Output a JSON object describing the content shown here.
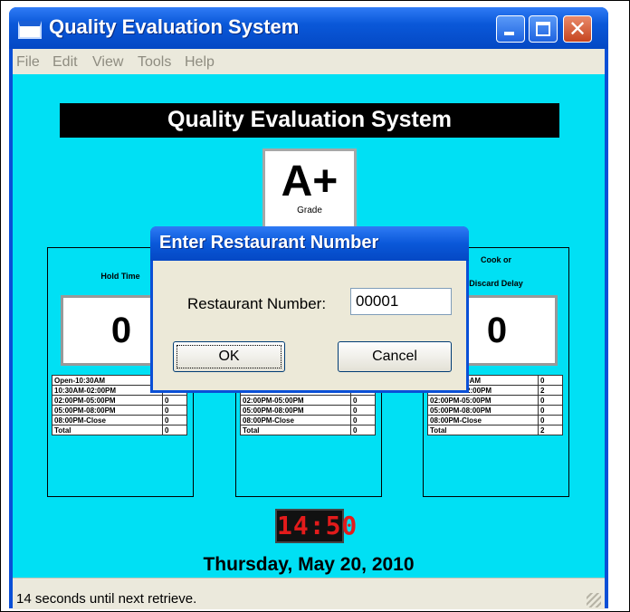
{
  "window": {
    "title": "Quality Evaluation System"
  },
  "title_buttons": {
    "close_glyph": "✕"
  },
  "menu": [
    "File",
    "Edit",
    "View",
    "Tools",
    "Help"
  ],
  "banner": "Quality Evaluation System",
  "grade": {
    "value": "A+",
    "label": "Grade"
  },
  "panels": [
    {
      "title_lines": [
        "Hold Time",
        ""
      ],
      "value": "0",
      "rows": [
        {
          "period": "Open-10:30AM",
          "count": ""
        },
        {
          "period": "10:30AM-02:00PM",
          "count": ""
        },
        {
          "period": "02:00PM-05:00PM",
          "count": "0"
        },
        {
          "period": "05:00PM-08:00PM",
          "count": "0"
        },
        {
          "period": "08:00PM-Close",
          "count": "0"
        },
        {
          "period": "Total",
          "count": "0"
        }
      ]
    },
    {
      "title_lines": [
        "",
        ""
      ],
      "value": "",
      "rows": [
        {
          "period": "",
          "count": ""
        },
        {
          "period": "",
          "count": ""
        },
        {
          "period": "02:00PM-05:00PM",
          "count": "0"
        },
        {
          "period": "05:00PM-08:00PM",
          "count": "0"
        },
        {
          "period": "08:00PM-Close",
          "count": "0"
        },
        {
          "period": "Total",
          "count": "0"
        }
      ]
    },
    {
      "title_lines": [
        "Cook or",
        "Discard Delay"
      ],
      "value": "0",
      "rows": [
        {
          "period": "Open-10:30AM",
          "count": "0"
        },
        {
          "period": "10:30AM-02:00PM",
          "count": "2"
        },
        {
          "period": "02:00PM-05:00PM",
          "count": "0"
        },
        {
          "period": "05:00PM-08:00PM",
          "count": "0"
        },
        {
          "period": "08:00PM-Close",
          "count": "0"
        },
        {
          "period": "Total",
          "count": "2"
        }
      ]
    }
  ],
  "clock": "14:50",
  "date": "Thursday, May 20, 2010",
  "status": "14 seconds until next retrieve.",
  "dialog": {
    "title": "Enter Restaurant Number",
    "label": "Restaurant Number:",
    "value": "00001",
    "ok": "OK",
    "cancel": "Cancel"
  }
}
